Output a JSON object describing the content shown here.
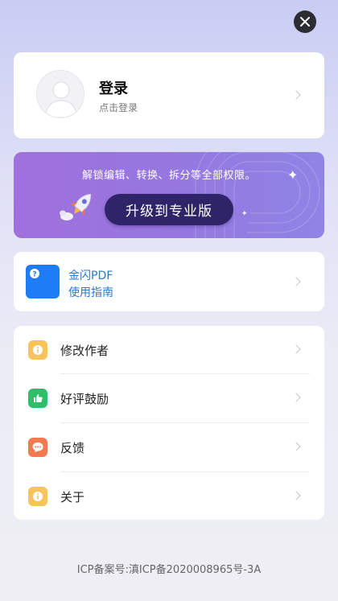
{
  "header": {
    "close_icon": "close-icon"
  },
  "login": {
    "title": "登录",
    "subtitle": "点击登录",
    "avatar_icon": "user-avatar-icon"
  },
  "promo": {
    "text": "解锁编辑、转换、拆分等全部权限。",
    "button_label": "升级到专业版",
    "rocket_icon": "rocket-icon",
    "sparkle_icon": "sparkle-icon"
  },
  "guide": {
    "title": "金闪PDF",
    "subtitle": "使用指南",
    "icon": "question-book-icon",
    "icon_color": "#1e7cf4"
  },
  "menu": {
    "items": [
      {
        "label": "修改作者",
        "icon": "info-icon",
        "color": "#f7c35a"
      },
      {
        "label": "好评鼓励",
        "icon": "thumbs-up-icon",
        "color": "#2fbf6a"
      },
      {
        "label": "反馈",
        "icon": "chat-bubble-icon",
        "color": "#f27a4f"
      },
      {
        "label": "关于",
        "icon": "info-icon",
        "color": "#f7c35a"
      }
    ]
  },
  "footer": {
    "icp": "ICP备案号:滇ICP备2020008965号-3A"
  }
}
